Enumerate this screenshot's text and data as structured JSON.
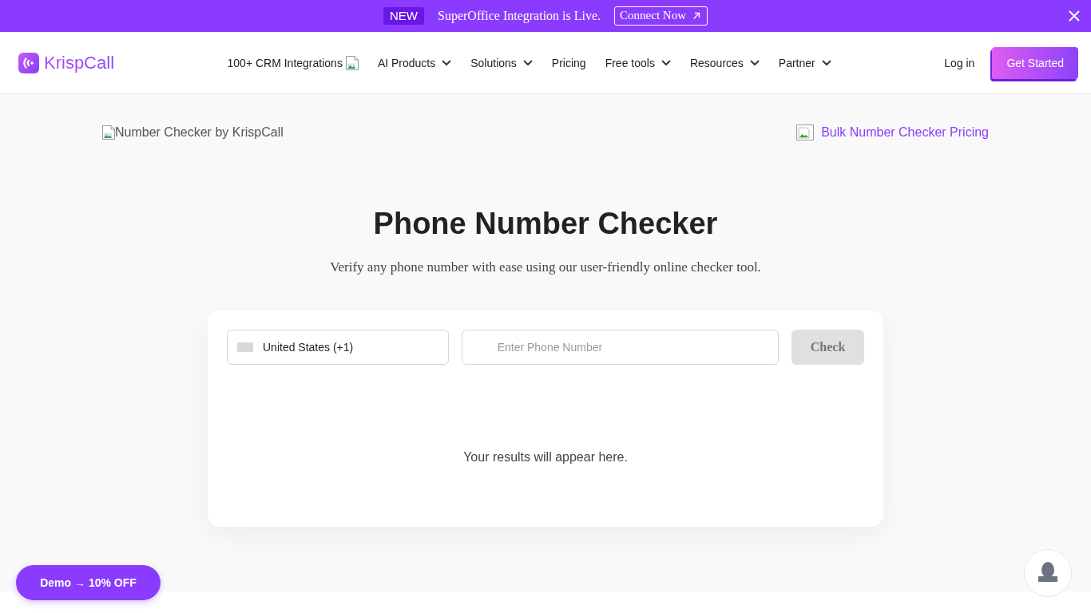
{
  "banner": {
    "badge": "NEW",
    "message": "SuperOffice Integration is Live.",
    "button": "Connect Now"
  },
  "nav": {
    "brand": "KrispCall",
    "items": [
      {
        "label": "100+ CRM Integrations",
        "kind": "image"
      },
      {
        "label": "AI Products",
        "kind": "dropdown"
      },
      {
        "label": "Solutions",
        "kind": "dropdown"
      },
      {
        "label": "Pricing",
        "kind": "link"
      },
      {
        "label": "Free tools",
        "kind": "dropdown"
      },
      {
        "label": "Resources",
        "kind": "dropdown"
      },
      {
        "label": "Partner",
        "kind": "dropdown"
      }
    ],
    "login": "Log in",
    "cta": "Get Started"
  },
  "hero": {
    "image_alt": "Number Checker by KrispCall",
    "pricing_link": "Bulk Number Checker Pricing",
    "title": "Phone Number Checker",
    "subtitle": "Verify any phone number with ease using our user-friendly online checker tool."
  },
  "checker": {
    "country": "United States (+1)",
    "phone_placeholder": "Enter Phone Number",
    "check_button": {
      "label": "Check",
      "disabled": true
    },
    "results": "Your results will appear here."
  },
  "demo_button": "Demo → 10% OFF"
}
